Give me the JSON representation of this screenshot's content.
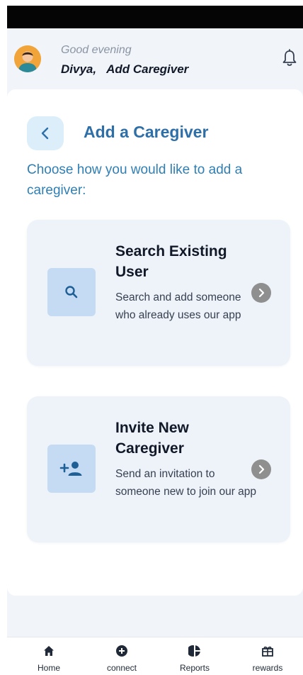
{
  "header": {
    "greeting": "Good evening",
    "user_name": "Divya,",
    "context_label": "Add Caregiver"
  },
  "page": {
    "title": "Add a Caregiver",
    "prompt": "Choose how you would like to add a caregiver:"
  },
  "options": [
    {
      "title": "Search Existing User",
      "description": "Search and add someone who already uses our app",
      "icon": "search-icon"
    },
    {
      "title": "Invite New Caregiver",
      "description": "Send an invitation to someone new to join our app",
      "icon": "person-add-icon"
    }
  ],
  "bottom_nav": {
    "items": [
      {
        "label": "Home",
        "icon": "home-icon"
      },
      {
        "label": "connect",
        "icon": "add-circle-icon"
      },
      {
        "label": "Reports",
        "icon": "pie-chart-icon"
      },
      {
        "label": "rewards",
        "icon": "gift-icon"
      }
    ]
  },
  "colors": {
    "accent": "#2f6fa8",
    "prompt": "#2f7fb5",
    "option_bg": "#eef2f9",
    "icon_tile": "#c5dbf3",
    "back_btn_bg": "#dbeefa"
  }
}
